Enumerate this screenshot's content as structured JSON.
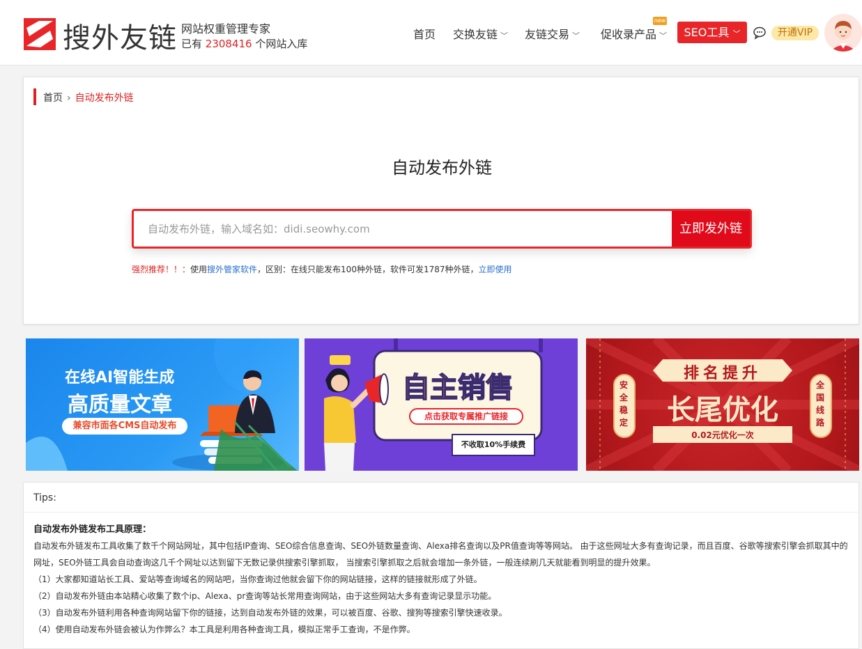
{
  "header": {
    "logo_text": "搜外友链",
    "slogan": "网站权重管理专家",
    "count_prefix": "已有",
    "count_value": "2308416",
    "count_suffix": "个网站入库",
    "nav": [
      {
        "label": "首页"
      },
      {
        "label": "交换友链"
      },
      {
        "label": "友链交易"
      },
      {
        "label": "促收录产品"
      }
    ],
    "new_badge": "new",
    "seo_button": "SEO工具",
    "vip_button": "开通VIP"
  },
  "breadcrumb": {
    "home": "首页",
    "current": "自动发布外链"
  },
  "main": {
    "title": "自动发布外链",
    "search_placeholder": "自动发布外链，输入域名如：didi.seowhy.com",
    "search_button": "立即发外链",
    "recommend_red": "强烈推荐！！：",
    "recommend_1": "使用",
    "recommend_link1": "搜外管家软件",
    "recommend_2": "，区别：在线只能发布100种外链，软件可发1787种外链，",
    "recommend_link2": "立即使用"
  },
  "banners": {
    "b1": {
      "line1": "在线AI智能生成",
      "line2": "高质量文章",
      "pill": "兼容市面各CMS自动发布"
    },
    "b2": {
      "title": "自主销售",
      "pill": "点击获取专属推广链接",
      "note": "不收取10%手续费"
    },
    "b3": {
      "ribbon": "排名提升",
      "title": "长尾优化",
      "price": "0.02元优化一次",
      "left_tag": "安全稳定",
      "right_tag": "全国线路"
    }
  },
  "tips": {
    "head": "Tips:",
    "title": "自动发布外链发布工具原理：",
    "p1": "自动发布外链发布工具收集了数千个网站网址，其中包括IP查询、SEO综合信息查询、SEO外链数量查询、Alexa排名查询以及PR值查询等等网站。 由于这些网址大多有查询记录，而且百度、谷歌等搜索引擎会抓取其中的",
    "p2": "网址，SEO外链工具会自动查询这几千个网址以达到留下无数记录供搜索引擎抓取，  当搜索引擎抓取之后就会增加一条外链，一般连续刷几天就能看到明显的提升效果。",
    "p3": "（1）大家都知道站长工具、爱站等查询域名的网站吧，当你查询过他就会留下你的网站链接，这样的链接就形成了外链。",
    "p4": "（2）自动发布外链由本站精心收集了数个ip、Alexa、pr查询等站长常用查询网站，由于这些网站大多有查询记录显示功能。",
    "p5": "（3）自动发布外链利用各种查询网站留下你的链接，达到自动发布外链的效果，可以被百度、谷歌、搜狗等搜索引擎快速收录。",
    "p6": "（4）使用自动发布外链会被认为作弊么？本工具是利用各种查询工具，模拟正常手工查询，不是作弊。"
  }
}
